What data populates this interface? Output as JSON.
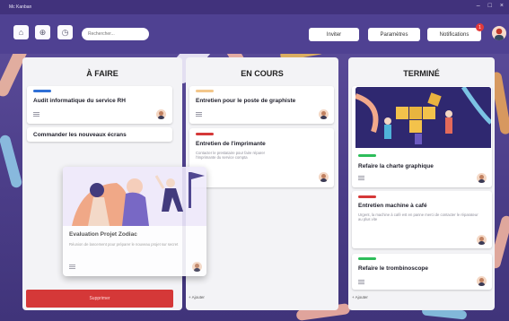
{
  "window": {
    "title": "Mc Kanban"
  },
  "toolbar": {
    "search_placeholder": "Rechercher...",
    "invite_label": "Inviter",
    "settings_label": "Paramètres",
    "notifications_label": "Notifications",
    "notification_count": "1"
  },
  "columns": {
    "todo": {
      "title": "À FAIRE",
      "cards": [
        {
          "title": "Audit informatique du service RH",
          "color": "#2f6fd6"
        },
        {
          "title": "Commander les nouveaux écrans"
        }
      ],
      "dragging_card": {
        "title": "Evaluation Projet Zodiac",
        "description": "Réunion de lancement pour préparer le nouveau projet sur secret"
      },
      "delete_label": "Supprimer"
    },
    "in_progress": {
      "title": "EN COURS",
      "cards": [
        {
          "title": "Entretien pour le poste de graphiste",
          "color": "#f3c78b"
        },
        {
          "title": "Entretien de l'imprimante",
          "color": "#d53838",
          "description": "Contacter le prestataire pour faire réparer l'imprimante du service compta"
        }
      ],
      "add_label": "+ Ajouter"
    },
    "done": {
      "title": "TERMINÉ",
      "cards": [
        {
          "title": "Refaire la charte graphique",
          "color": "#2dbd5a"
        },
        {
          "title": "Entretien machine à café",
          "color": "#d53838",
          "description": "Urgent, la machine à café est en panne merci de contacter le réparateur au plus vite"
        },
        {
          "title": "Refaire le trombinoscope",
          "color": "#2dbd5a"
        }
      ],
      "add_label": "+ Ajouter"
    }
  }
}
